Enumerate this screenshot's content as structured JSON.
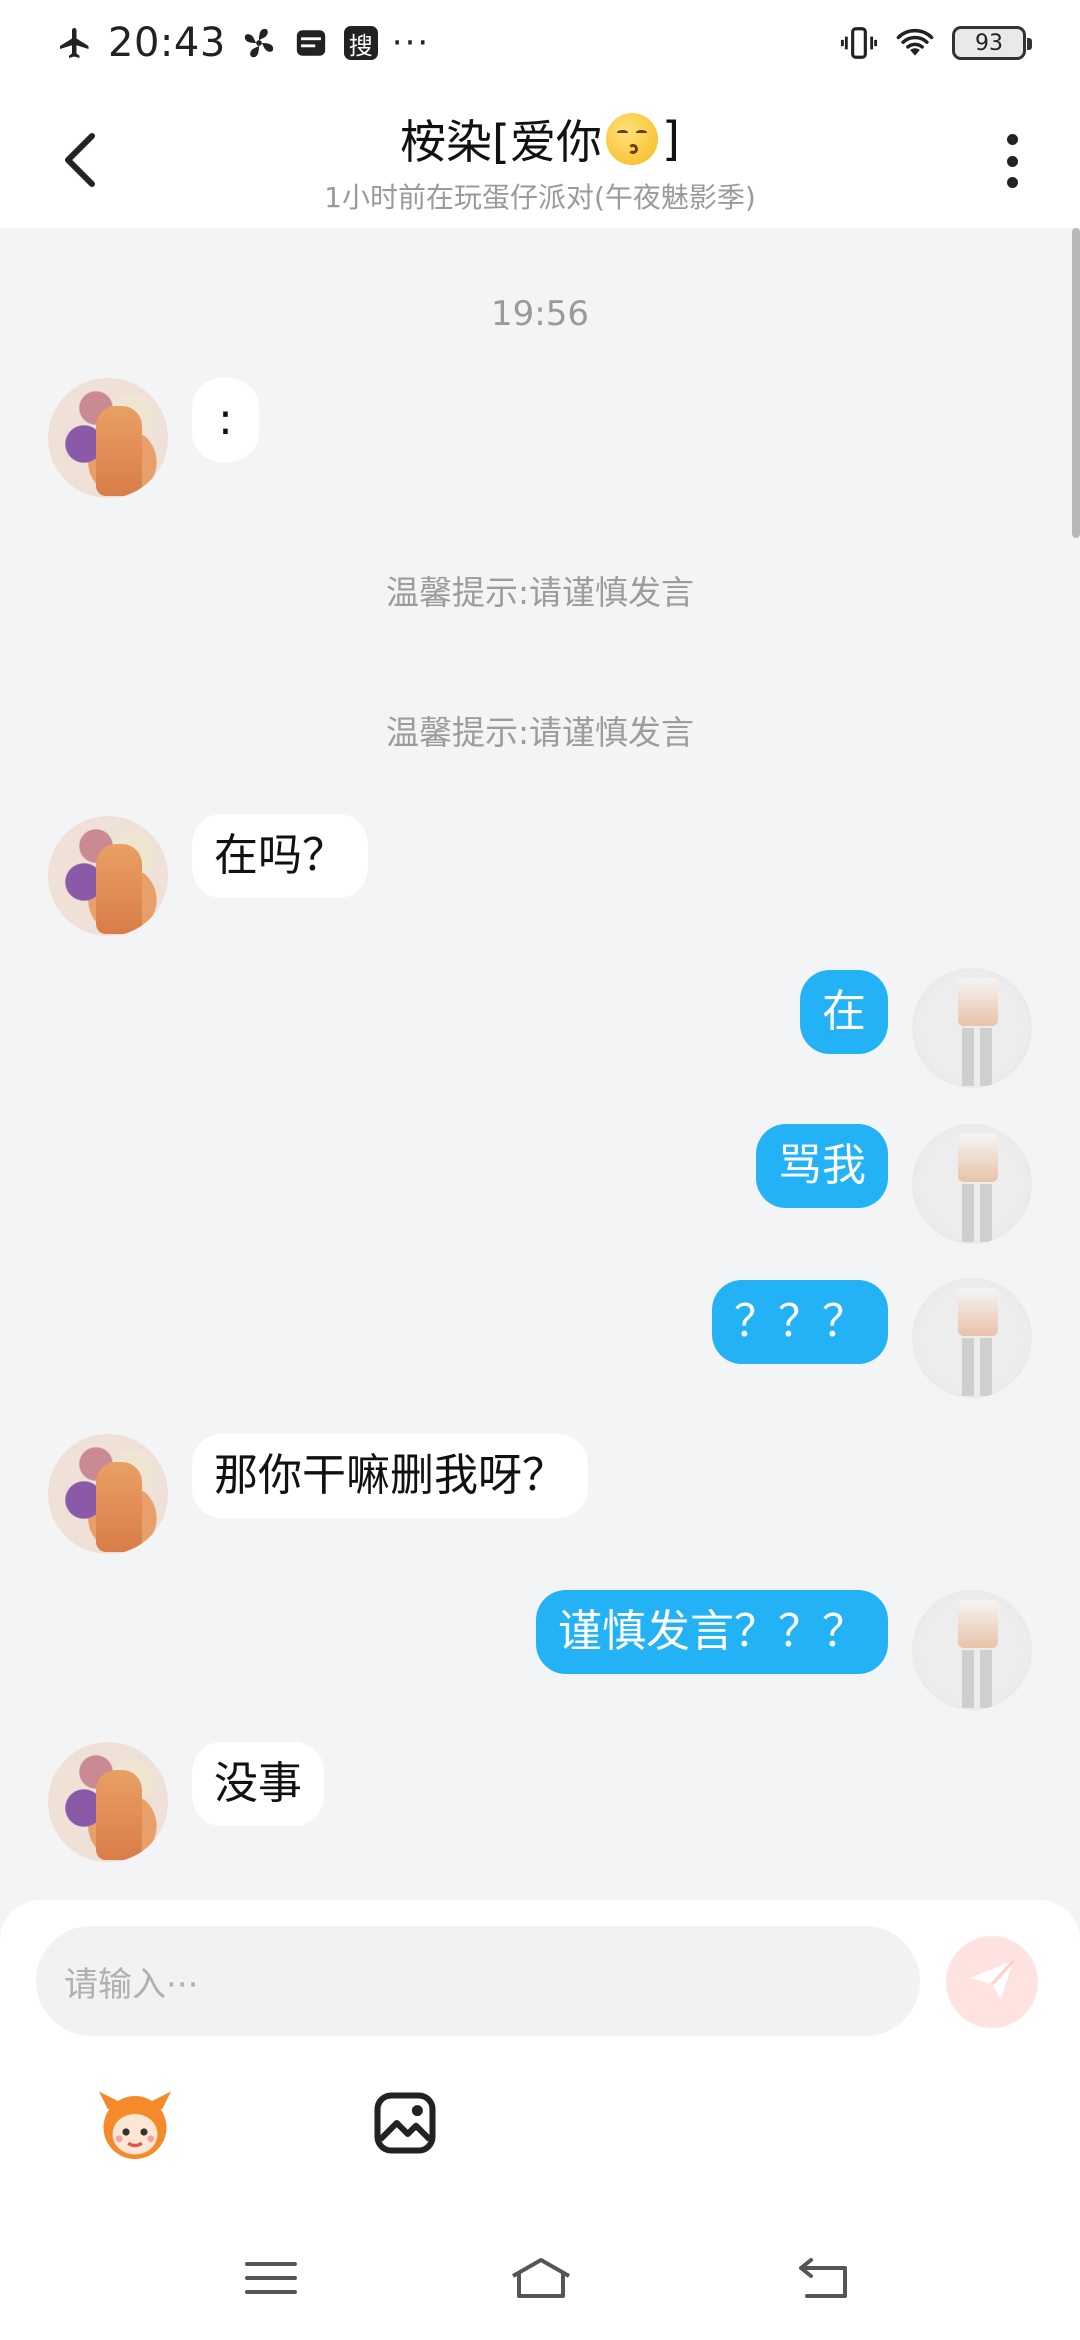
{
  "status_bar": {
    "time": "20:43",
    "badge_search": "搜",
    "more": "···",
    "battery": "93"
  },
  "header": {
    "title_name": "桉染[爱你",
    "title_end": "]",
    "subtitle": "1小时前在玩蛋仔派对(午夜魅影季)"
  },
  "chat": {
    "timestamp": "19:56",
    "tips": [
      "温馨提示:请谨慎发言",
      "温馨提示:请谨慎发言"
    ],
    "messages": [
      {
        "side": "in",
        "text": ":"
      },
      {
        "side": "in",
        "text": "在吗？"
      },
      {
        "side": "out",
        "text": "在"
      },
      {
        "side": "out",
        "text": "骂我"
      },
      {
        "side": "out",
        "text": "？？？"
      },
      {
        "side": "in",
        "text": "那你干嘛删我呀？"
      },
      {
        "side": "out",
        "text": "谨慎发言？？？"
      },
      {
        "side": "in",
        "text": "没事"
      }
    ]
  },
  "composer": {
    "placeholder": "请输入···"
  },
  "colors": {
    "outgoing_bubble": "#22b2f5",
    "incoming_bubble": "#ffffff",
    "background": "#f3f4f6"
  },
  "icons": [
    "airplane-mode-icon",
    "fan-icon",
    "card-icon",
    "vibrate-icon",
    "wifi-icon",
    "back-arrow-icon",
    "more-vertical-icon",
    "send-icon",
    "mascot-emoji-icon",
    "image-icon",
    "menu-icon",
    "home-icon",
    "back-nav-icon"
  ]
}
